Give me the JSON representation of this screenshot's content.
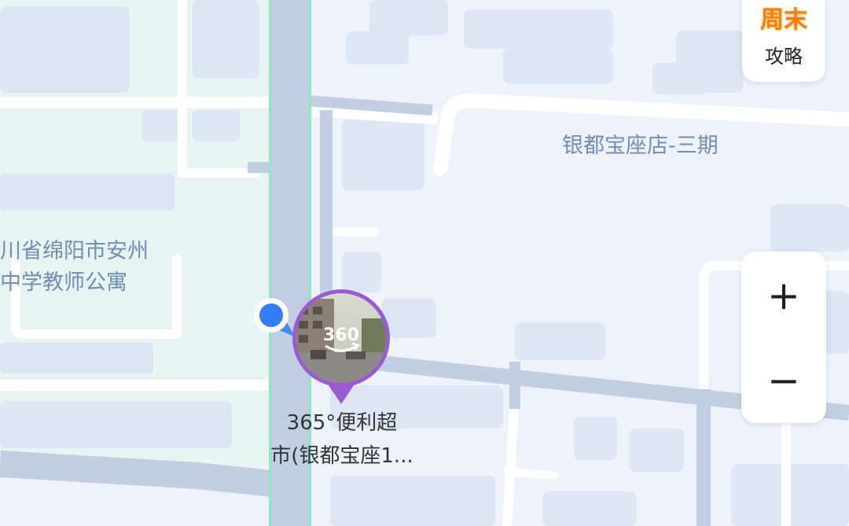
{
  "map": {
    "colors": {
      "block": "#eef3fb",
      "block_green": "#e6f4f2",
      "building": "#dde6f4",
      "road_major": "#c2cfe2",
      "road_minor": "#ffffff",
      "road_edge": "#97e3c6",
      "label": "#6f8db7",
      "poi_purple": "#9b59d6",
      "location_blue": "#2f7ef3"
    },
    "labels": {
      "mall": "银都宝座店-三期",
      "apartment_line1": "川省绵阳市安州",
      "apartment_line2": "中学教师公寓"
    },
    "poi": {
      "badge_text": "360",
      "name_line1": "365°便利超",
      "name_line2": "市(银都宝座1..."
    }
  },
  "promo": {
    "badge": "周末",
    "label": "攻略"
  },
  "zoom": {
    "in_label": "+",
    "out_label": "−"
  }
}
